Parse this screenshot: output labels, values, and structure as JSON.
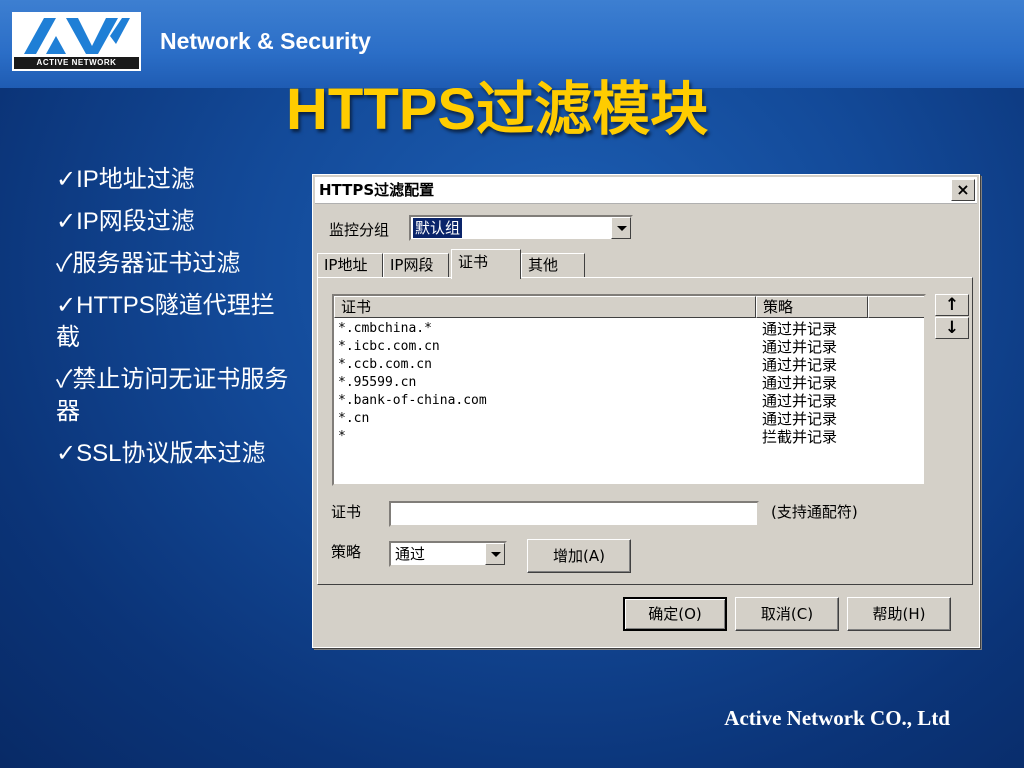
{
  "header": {
    "logo_text": "ACTIVE NETWORK",
    "tagline": "Network & Security",
    "title": "HTTPS过滤模块"
  },
  "bullets": [
    {
      "check": "✓",
      "text": "IP地址过滤"
    },
    {
      "check": "✓",
      "text": "IP网段过滤"
    },
    {
      "check": "✓",
      "text": "服务器证书过滤"
    },
    {
      "check": "✓",
      "text": "HTTPS隧道代理拦截"
    },
    {
      "check": "✓",
      "text": "禁止访问无证书服务器"
    },
    {
      "check": "✓",
      "text": "SSL协议版本过滤"
    }
  ],
  "footer": "Active Network CO., Ltd",
  "dialog": {
    "title": "HTTPS过滤配置",
    "close": "×",
    "group_label": "监控分组",
    "group_value": "默认组",
    "tabs": [
      "IP地址",
      "IP网段",
      "证书",
      "其他"
    ],
    "active_tab": "证书",
    "list": {
      "columns": [
        "证书",
        "策略"
      ],
      "rows": [
        {
          "cert": "*.cmbchina.*",
          "policy": "通过并记录"
        },
        {
          "cert": "*.icbc.com.cn",
          "policy": "通过并记录"
        },
        {
          "cert": "*.ccb.com.cn",
          "policy": "通过并记录"
        },
        {
          "cert": "*.95599.cn",
          "policy": "通过并记录"
        },
        {
          "cert": "*.bank-of-china.com",
          "policy": "通过并记录"
        },
        {
          "cert": "*.cn",
          "policy": "通过并记录"
        },
        {
          "cert": "*",
          "policy": "拦截并记录"
        }
      ]
    },
    "move_up": "↑",
    "move_down": "↓",
    "cert_label": "证书",
    "cert_value": "",
    "cert_hint": "(支持通配符)",
    "policy_label": "策略",
    "policy_value": "通过",
    "add_button": "增加(A)",
    "ok_button": "确定(O)",
    "cancel_button": "取消(C)",
    "help_button": "帮助(H)"
  },
  "colors": {
    "title": "#ffcc00",
    "background": "#134a99",
    "dialog": "#d4d0c8",
    "logo_blue": "#1f7fd6"
  }
}
